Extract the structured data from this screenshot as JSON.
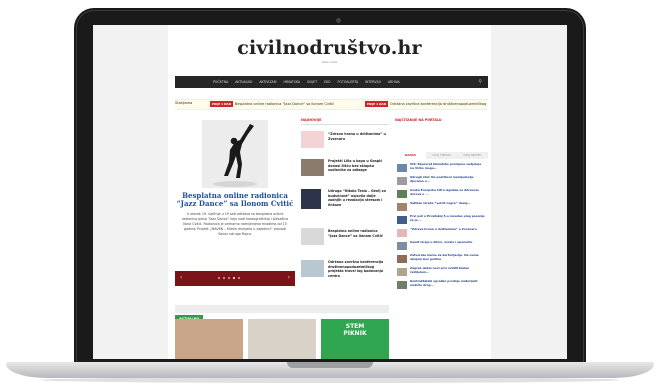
{
  "site": {
    "logo": "civilnodruštvo.hr",
    "tagline": "Glas civila"
  },
  "nav": {
    "items": [
      "POČETNA",
      "AKTUALNO",
      "AKTIVIZAM",
      "HRVATSKA",
      "SVIJET",
      "EKO",
      "FOTOALERTA",
      "INTERVJUI",
      "ARHIVA"
    ]
  },
  "ticker": [
    {
      "badge": "",
      "text": "Stazijama"
    },
    {
      "badge": "PRIJE 1 DAN",
      "text": "Besplatna online radionica “Jazz Dance” sa Ilonom Cvitić"
    },
    {
      "badge": "PRIJE 1 DAN",
      "text": "Održana završna konferencija društvenopoduzetničkog"
    }
  ],
  "hero": {
    "title": "Besplatna online radionica “Jazz Dance” sa Ilonom Cvitić",
    "text": "U utorak 19. siječnja u 19 sati održava se besplatna online radionica plesa “Jazz Dance” koju vodi koreografkinja i plesačica Ilona Cvitić. Radionica je primarno namijenjena mladima od 15 godina. Projekt „MAVEN – Mreža mirnjaka u zajednici“ provodi Savez udruga Rojca."
  },
  "middle": {
    "section_label": "NAJNOVIJE",
    "items": [
      {
        "title": "“Zdrava hrana u dvištanima” u Zvornaru"
      },
      {
        "title": "Projekti Lilia u kapu u Gospić donosi čišću bez sklopku sudionike za odlazge"
      },
      {
        "title": "Udruga “Nikola Tesla – Genij za budućnost” najavila dolje zadnjih u rezalacija stresom i linkaze"
      },
      {
        "title": "Besplatna online radionica “Jazz Dance” sa Ilonom Cvitić"
      },
      {
        "title": "Održana završna konferencija društvenopoduzetničkog projekta travel log bodovanja centra"
      }
    ]
  },
  "right": {
    "head": "NAJČITANIJE NA PORTALU",
    "tabs": [
      "DANAS",
      "OVAJ TJEDAN",
      "OVAJ MJESEC"
    ],
    "items": [
      {
        "title": "VIS: Rzpevrat klimatske promjene sudjeluje na Vičko mogu..."
      },
      {
        "title": "Okrugli stol: Ne postiheni manipulacije djecama u..."
      },
      {
        "title": "Svaka Europska Cifra izgubila se Zdravom dorova u ..."
      },
      {
        "title": "Vatikan izrada “velvit negre” desig..."
      },
      {
        "title": "Prvi put u Hrvatskoj 5-u moodes plug pesonje za je..."
      },
      {
        "title": "“Zdrava hrana u dvištanima” u Zvornaru"
      },
      {
        "title": "Samit izraje u klinic, zvralo i upozorilo"
      },
      {
        "title": "Zatvorske kazne za korforijaciju. Da nema ubojem bez godina"
      },
      {
        "title": "Zagreb dobio novi prvi svlidit blalan razlijelem..."
      },
      {
        "title": "Kontraktatski opraško prodnje materijalli metičle drog..."
      }
    ]
  },
  "aktualno": {
    "label": "AKTUALNO",
    "card_text": "STEM PIKNIK"
  },
  "colors": {
    "accent_red": "#c8282d",
    "link_blue": "#1f4e9c",
    "nav_dark": "#262626",
    "slider_bar": "#7a1419",
    "aktualno_green": "#3a9b3e"
  }
}
